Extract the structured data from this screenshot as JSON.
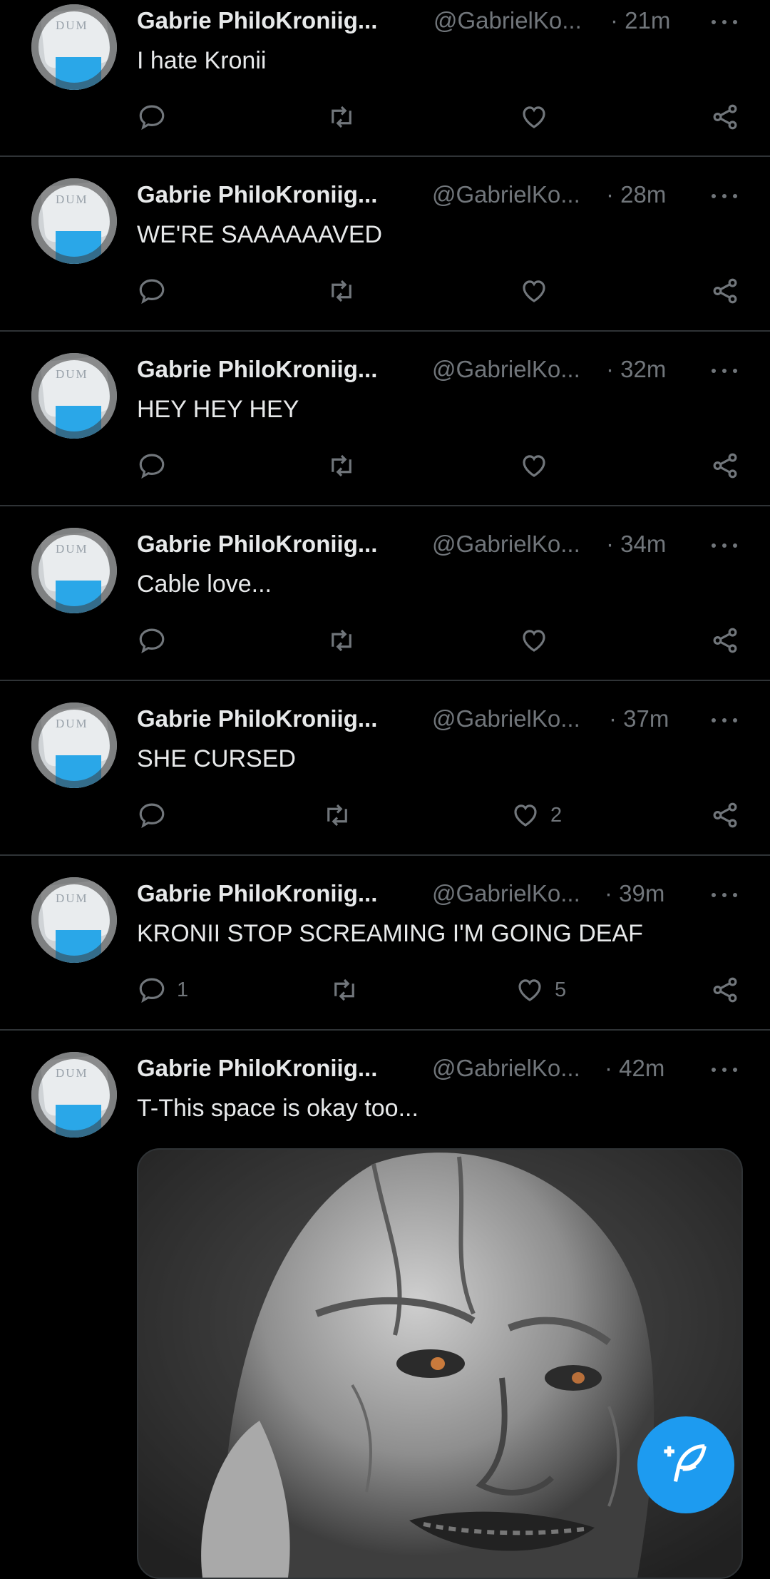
{
  "tweets": [
    {
      "name": "Gabrie PhiloKroniig...",
      "handle": "@GabrielKo...",
      "time": "· 21m",
      "text": "I hate Kronii",
      "replies": "",
      "likes": ""
    },
    {
      "name": "Gabrie PhiloKroniig...",
      "handle": "@GabrielKo...",
      "time": "· 28m",
      "text": "WE'RE SAAAAAAVED",
      "replies": "",
      "likes": ""
    },
    {
      "name": "Gabrie PhiloKroniig...",
      "handle": "@GabrielKo...",
      "time": "· 32m",
      "text": "HEY HEY HEY",
      "replies": "",
      "likes": ""
    },
    {
      "name": "Gabrie PhiloKroniig...",
      "handle": "@GabrielKo...",
      "time": "· 34m",
      "text": "Cable love...",
      "replies": "",
      "likes": ""
    },
    {
      "name": "Gabrie PhiloKroniig...",
      "handle": "@GabrielKo...",
      "time": "· 37m",
      "text": "SHE CURSED",
      "replies": "",
      "likes": "2"
    },
    {
      "name": "Gabrie PhiloKroniig...",
      "handle": "@GabrielKo...",
      "time": "· 39m",
      "text": "KRONII STOP SCREAMING I'M GOING DEAF",
      "replies": "1",
      "likes": "5"
    },
    {
      "name": "Gabrie PhiloKroniig...",
      "handle": "@GabrielKo...",
      "time": "· 42m",
      "text": "T-This space is okay too...",
      "replies": "",
      "likes": ""
    }
  ],
  "avatar_text": "DUM",
  "icons": {
    "reply": "reply-icon",
    "retweet": "retweet-icon",
    "like": "heart-icon",
    "share": "share-icon",
    "more": "more-icon",
    "compose": "compose-feather-icon"
  },
  "colors": {
    "accent": "#1d9bf0",
    "muted": "#71767b",
    "text": "#e7e9ea",
    "divider": "#2f3336"
  }
}
